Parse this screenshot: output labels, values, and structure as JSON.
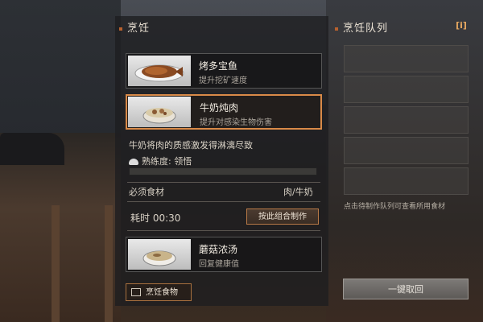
{
  "left_panel": {
    "title": "烹饪",
    "recipes": [
      {
        "name": "烤多宝鱼",
        "desc": "提升挖矿速度"
      },
      {
        "name": "牛奶炖肉",
        "desc": "提升对感染生物伤害"
      },
      {
        "name": "蘑菇浓汤",
        "desc": "回复健康值"
      }
    ],
    "selected_index": 1,
    "detail": {
      "flavor_text": "牛奶将肉的质感激发得淋漓尽致",
      "proficiency_label": "熟练度: 领悟",
      "proficiency_fraction": 0.0,
      "ingredients_label": "必须食材",
      "ingredients_value": "肉/牛奶",
      "time_label": "耗时 00:30",
      "make_button": "按此组合制作"
    },
    "cook_button": "烹饪食物"
  },
  "right_panel": {
    "title": "烹饪队列",
    "info_icon": "i",
    "queue_slots": 5,
    "hint": "点击待制作队列可查看所用食材",
    "cancel_button": "一键取回"
  },
  "colors": {
    "accent": "#d98a48",
    "title_dot": "#b8612e"
  }
}
